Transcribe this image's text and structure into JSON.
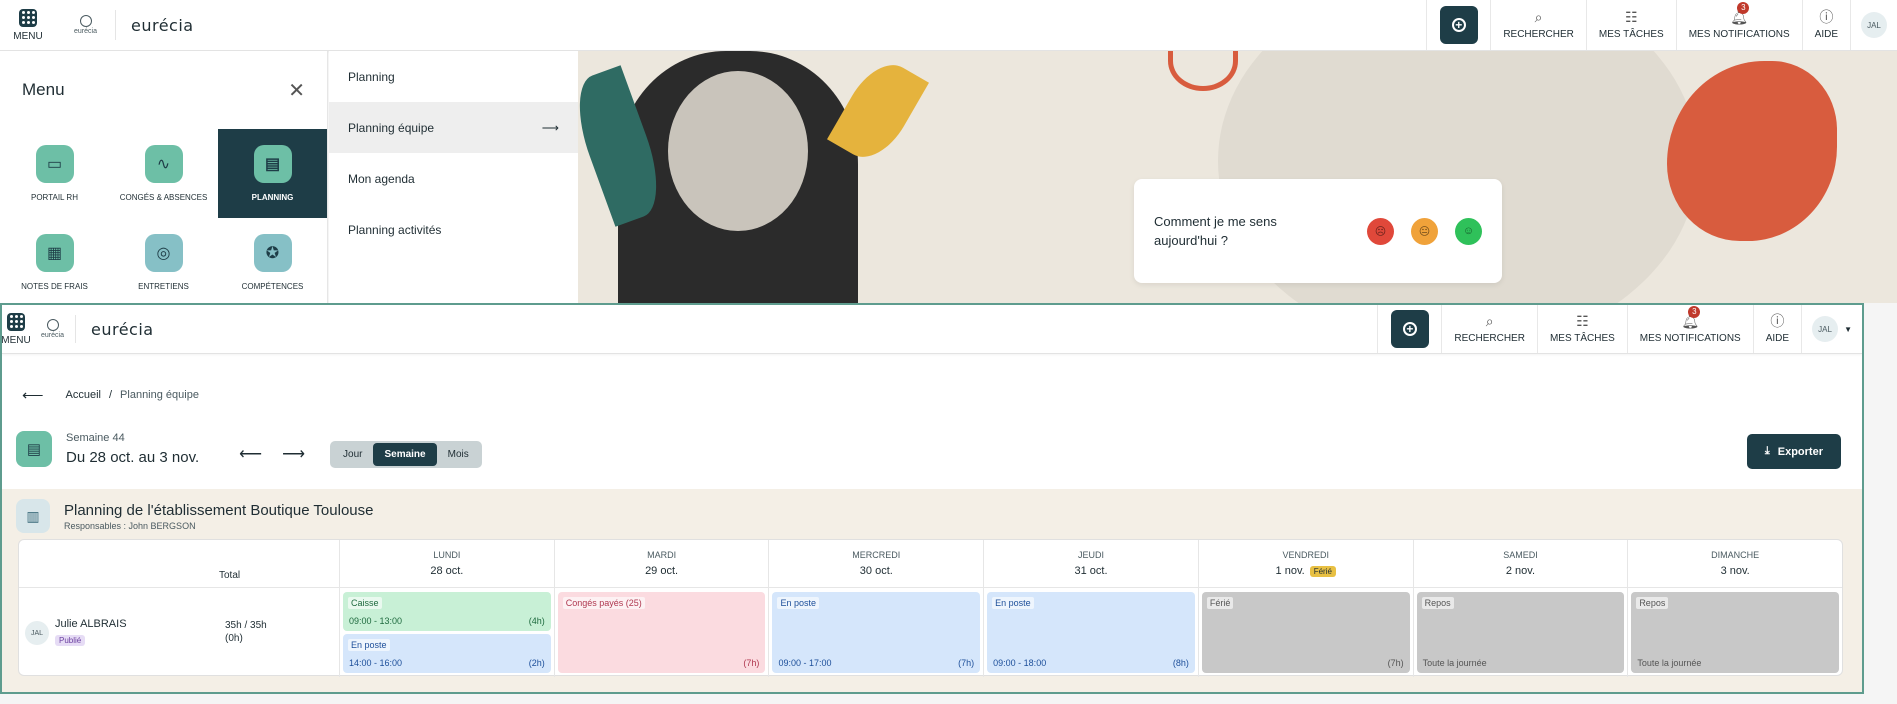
{
  "top_nav": {
    "menu_label": "MENU",
    "logo_small": "eurécia",
    "brand": "eurécia",
    "search": "RECHERCHER",
    "tasks": "MES TÂCHES",
    "notifications": "MES NOTIFICATIONS",
    "notif_count": "3",
    "help": "AIDE",
    "avatar": "JAL"
  },
  "menu": {
    "title": "Menu",
    "tiles": [
      {
        "label": "PORTAIL RH"
      },
      {
        "label": "CONGÉS & ABSENCES"
      },
      {
        "label": "PLANNING"
      },
      {
        "label": "NOTES DE FRAIS"
      },
      {
        "label": "ENTRETIENS"
      },
      {
        "label": "COMPÉTENCES"
      }
    ],
    "submenu": [
      {
        "label": "Planning"
      },
      {
        "label": "Planning équipe"
      },
      {
        "label": "Mon agenda"
      },
      {
        "label": "Planning activités"
      }
    ]
  },
  "mood": {
    "question": "Comment je me sens aujourd'hui ?"
  },
  "breadcrumb": {
    "home": "Accueil",
    "sep": "/",
    "current": "Planning équipe"
  },
  "week": {
    "number": "Semaine 44",
    "range": "Du 28 oct. au 3 nov.",
    "views": [
      "Jour",
      "Semaine",
      "Mois"
    ],
    "export": "Exporter"
  },
  "planning": {
    "title": "Planning de l'établissement Boutique Toulouse",
    "responsables": "Responsables : John BERGSON",
    "total_header": "Total",
    "days": [
      {
        "name": "LUNDI",
        "date": "28 oct."
      },
      {
        "name": "MARDI",
        "date": "29 oct."
      },
      {
        "name": "MERCREDI",
        "date": "30 oct."
      },
      {
        "name": "JEUDI",
        "date": "31 oct."
      },
      {
        "name": "VENDREDI",
        "date": "1 nov.",
        "tag": "Férié"
      },
      {
        "name": "SAMEDI",
        "date": "2 nov."
      },
      {
        "name": "DIMANCHE",
        "date": "3 nov."
      }
    ],
    "employee": {
      "initials": "JAL",
      "name": "Julie ALBRAIS",
      "status": "Publié",
      "hours": "35h / 35h",
      "diff": "(0h)"
    },
    "blocks": {
      "mon_1": {
        "label": "Caisse",
        "time": "09:00 - 13:00",
        "dur": "(4h)"
      },
      "mon_2": {
        "label": "En poste",
        "time": "14:00 - 16:00",
        "dur": "(2h)"
      },
      "tue": {
        "label": "Congés payés (25)",
        "dur": "(7h)"
      },
      "wed": {
        "label": "En poste",
        "time": "09:00 - 17:00",
        "dur": "(7h)"
      },
      "thu": {
        "label": "En poste",
        "time": "09:00 - 18:00",
        "dur": "(8h)"
      },
      "fri": {
        "label": "Férié",
        "dur": "(7h)"
      },
      "sat": {
        "label": "Repos",
        "time": "Toute la journée"
      },
      "sun": {
        "label": "Repos",
        "time": "Toute la journée"
      }
    }
  },
  "colors": {
    "primary": "#1e3d47",
    "accent": "#6dbfa6",
    "mood_bad": "#e0483a",
    "mood_mid": "#f0a23a",
    "mood_good": "#2fc15a"
  }
}
